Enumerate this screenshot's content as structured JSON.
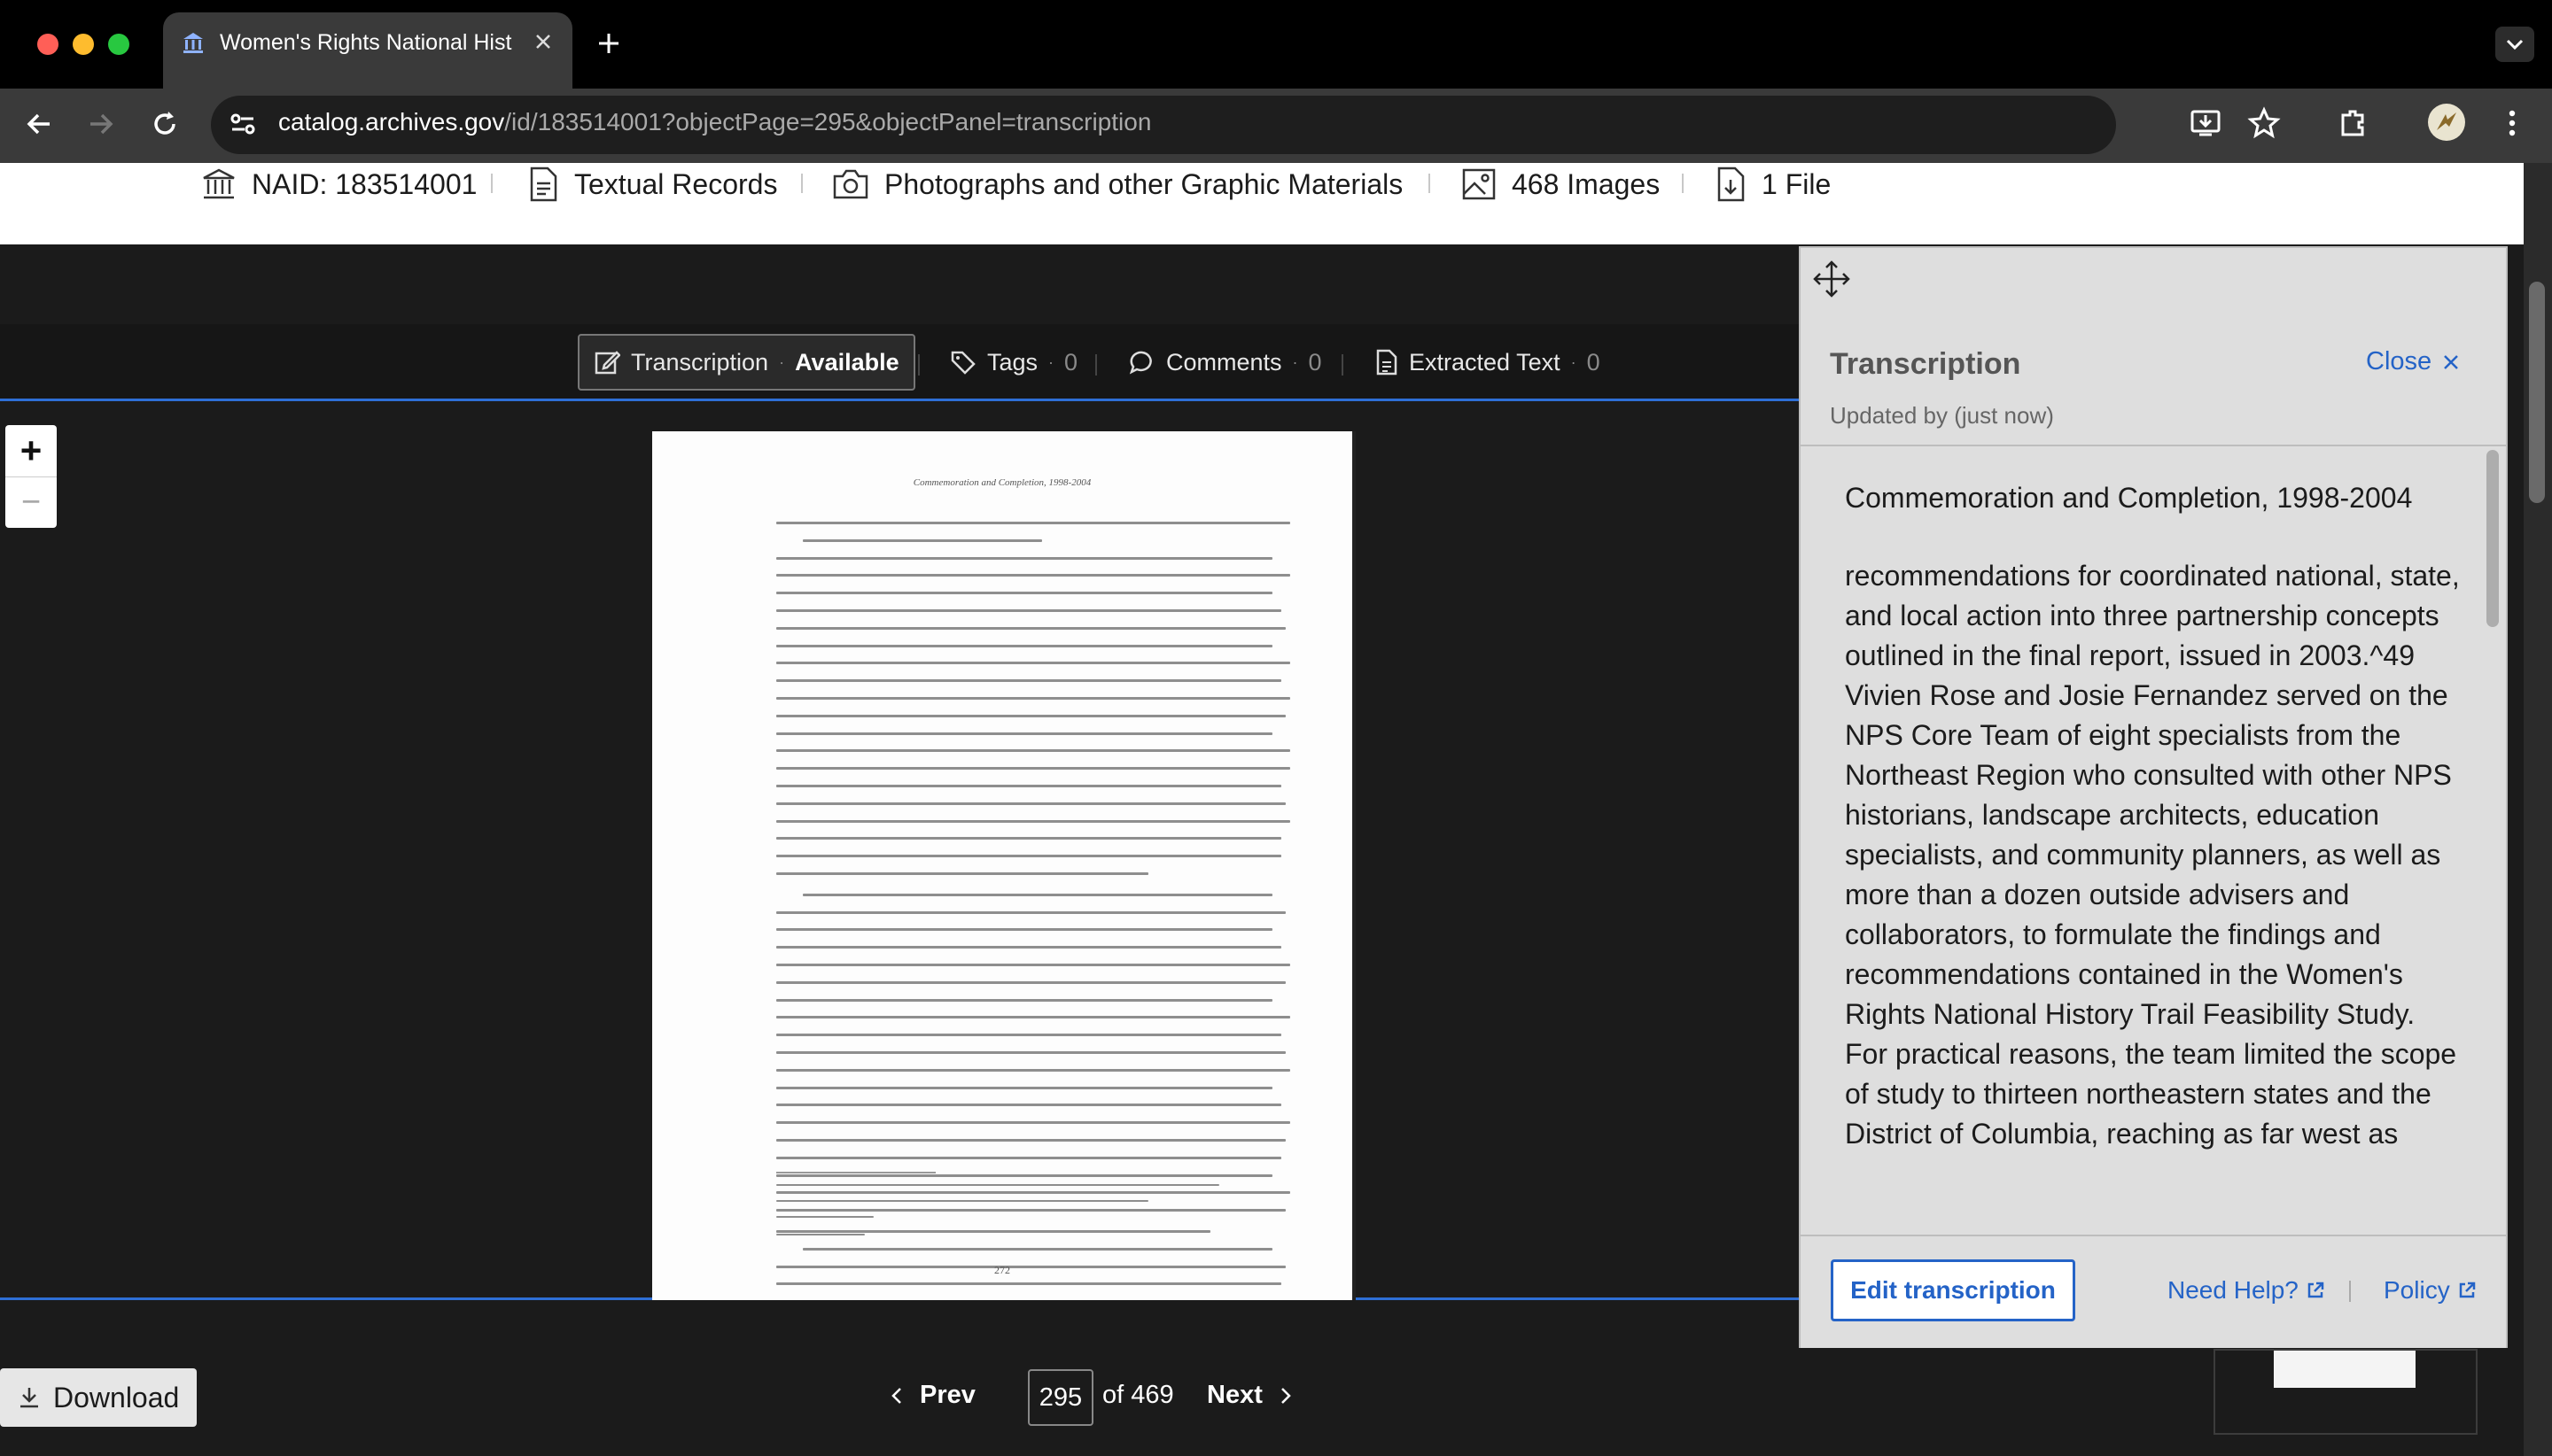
{
  "browser": {
    "tab_title": "Women's Rights National Hist",
    "url_host": "catalog.archives.gov",
    "url_path": "/id/183514001?objectPage=295&objectPanel=transcription"
  },
  "meta": {
    "naid": "NAID: 183514001",
    "textual": "Textual Records",
    "photos": "Photographs and other Graphic Materials",
    "images": "468 Images",
    "files": "1 File"
  },
  "viewer_tabs": {
    "transcription_label": "Transcription",
    "transcription_status": "Available",
    "tags_label": "Tags",
    "tags_count": "0",
    "comments_label": "Comments",
    "comments_count": "0",
    "extracted_label": "Extracted Text",
    "extracted_count": "0"
  },
  "zoom": {
    "in": "+",
    "out": "−"
  },
  "document_page": {
    "running_head": "Commemoration and Completion, 1998-2004",
    "page_number": "272"
  },
  "bottom": {
    "download": "Download",
    "prev": "Prev",
    "current_page": "295",
    "of_total": "of 469",
    "next": "Next"
  },
  "panel": {
    "title": "Transcription",
    "close": "Close",
    "updated": "Updated by (just now)",
    "heading": "Commemoration and Completion, 1998-2004",
    "body": "recommendations for coordinated national, state, and local action into three partnership concepts outlined in the final report, issued in 2003.^49\nVivien Rose and Josie Fernandez served on the NPS Core Team of eight specialists from the Northeast Region who consulted with other NPS historians, landscape architects, education specialists, and community planners, as well as more than a dozen outside advisers and collaborators, to formulate the findings and recommendations contained in the Women's Rights National History Trail Feasibility Study. For practical reasons, the team limited the scope of study to thirteen northeastern states and the District of Columbia, reaching as far west as",
    "edit": "Edit transcription",
    "help": "Need Help?",
    "policy": "Policy"
  },
  "colors": {
    "link": "#2463c7",
    "accent_line": "#2e6fd6"
  }
}
